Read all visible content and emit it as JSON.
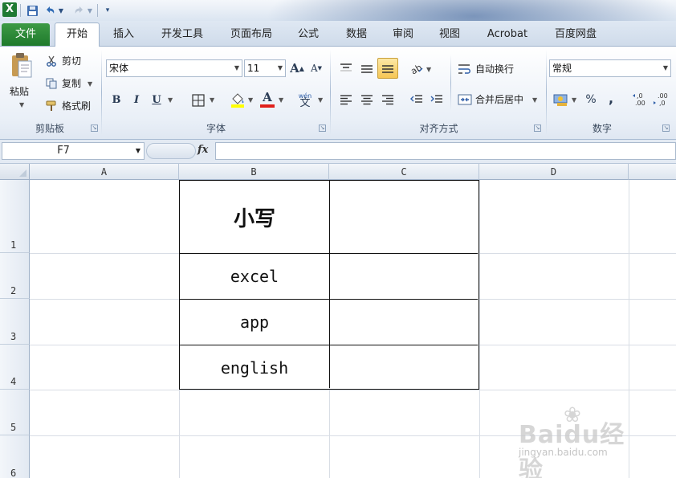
{
  "quick_access": {
    "app_icon": "X"
  },
  "tabs": {
    "file": "文件",
    "items": [
      "开始",
      "插入",
      "开发工具",
      "页面布局",
      "公式",
      "数据",
      "审阅",
      "视图",
      "Acrobat",
      "百度网盘"
    ]
  },
  "ribbon": {
    "clipboard": {
      "paste": "粘贴",
      "cut": "剪切",
      "copy": "复制",
      "format_painter": "格式刷",
      "group_label": "剪贴板"
    },
    "font": {
      "font_name": "宋体",
      "font_size": "11",
      "group_label": "字体",
      "bold": "B",
      "italic": "I",
      "underline": "U",
      "grow": "A",
      "shrink": "A",
      "font_color": "A",
      "phonetic": "wén"
    },
    "alignment": {
      "wrap_text": "自动换行",
      "merge_center": "合并后居中",
      "group_label": "对齐方式"
    },
    "number": {
      "format": "常规",
      "percent": "%",
      "comma": ",",
      "inc_decimal": "+.0\n.00",
      "dec_decimal": ".00\n→.0",
      "group_label": "数字"
    }
  },
  "formula_bar": {
    "name_box": "F7",
    "fx": "fx",
    "formula": ""
  },
  "grid": {
    "columns": [
      "A",
      "B",
      "C",
      "D"
    ],
    "rows": [
      "1",
      "2",
      "3",
      "4",
      "5",
      "6"
    ],
    "cells": {
      "B1": "小写",
      "B2": "excel",
      "B3": "app",
      "B4": "english"
    }
  },
  "watermark": {
    "brand": "Baidu经验",
    "url": "jingyan.baidu.com"
  }
}
